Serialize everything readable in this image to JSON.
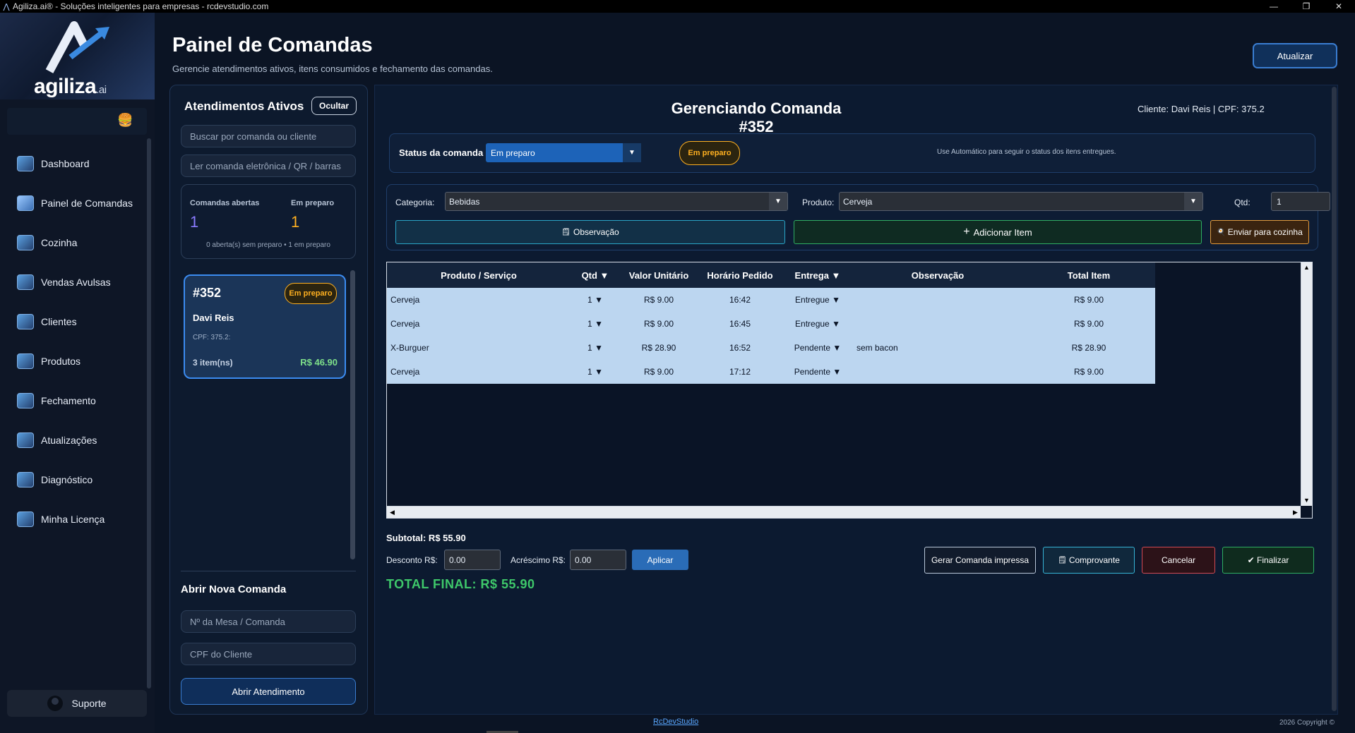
{
  "window": {
    "title": "Agiliza.ai® - Soluções inteligentes para empresas - rcdevstudio.com",
    "minimize": "—",
    "maximize": "❐",
    "close": "✕"
  },
  "sidebar": {
    "logo_main": "agiliza",
    "logo_suffix": ".ai",
    "items": [
      {
        "label": "Dashboard",
        "icon": "dashboard-icon"
      },
      {
        "label": "Painel de Comandas",
        "icon": "orders-panel-icon"
      },
      {
        "label": "Cozinha",
        "icon": "kitchen-icon"
      },
      {
        "label": "Vendas Avulsas",
        "icon": "sales-icon"
      },
      {
        "label": "Clientes",
        "icon": "clients-icon"
      },
      {
        "label": "Produtos",
        "icon": "products-icon"
      },
      {
        "label": "Fechamento",
        "icon": "closing-icon"
      },
      {
        "label": "Atualizações",
        "icon": "updates-icon"
      },
      {
        "label": "Diagnóstico",
        "icon": "diagnostics-icon"
      },
      {
        "label": "Minha Licença",
        "icon": "license-icon"
      }
    ],
    "support_label": "Suporte"
  },
  "header": {
    "title": "Painel de Comandas",
    "subtitle": "Gerencie atendimentos ativos, itens consumidos e fechamento das comandas.",
    "refresh_label": "Atualizar"
  },
  "active": {
    "title": "Atendimentos Ativos",
    "hide_label": "Ocultar",
    "search_placeholder": "Buscar por comanda ou cliente",
    "scan_placeholder": "Ler comanda eletrônica / QR / barras",
    "stats": {
      "open_label": "Comandas abertas",
      "open_value": "1",
      "prep_label": "Em preparo",
      "prep_value": "1",
      "note": "0 aberta(s) sem preparo • 1 em preparo"
    },
    "card": {
      "id": "#352",
      "status": "Em preparo",
      "name": "Davi Reis",
      "cpf": "CPF: 375.2:",
      "items": "3 item(ns)",
      "total": "R$ 46.90"
    },
    "new": {
      "title": "Abrir Nova Comanda",
      "table_placeholder": "Nº da Mesa / Comanda",
      "cpf_placeholder": "CPF do Cliente",
      "open_label": "Abrir Atendimento"
    }
  },
  "main": {
    "title": "Gerenciando Comanda #352",
    "client": "Cliente: Davi Reis  |  CPF: 375.2",
    "status": {
      "label": "Status da comanda",
      "value": "Em preparo",
      "badge": "Em preparo",
      "hint": "Use Automático para seguir o status dos itens entregues."
    },
    "add": {
      "category_label": "Categoria:",
      "category_value": "Bebidas",
      "product_label": "Produto:",
      "product_value": "Cerveja",
      "qty_label": "Qtd:",
      "qty_value": "1",
      "obs_label": "Observação",
      "add_label": "Adicionar Item",
      "kitchen_label": "Enviar para cozinha"
    },
    "table": {
      "headers": [
        "Produto / Serviço",
        "Qtd  ▼",
        "Valor Unitário",
        "Horário Pedido",
        "Entrega  ▼",
        "Observação",
        "Total Item"
      ],
      "rows": [
        {
          "produto": "Cerveja",
          "qtd": "1",
          "unit": "R$ 9.00",
          "hora": "16:42",
          "entrega": "Entregue",
          "obs": "",
          "total": "R$ 9.00"
        },
        {
          "produto": "Cerveja",
          "qtd": "1",
          "unit": "R$ 9.00",
          "hora": "16:45",
          "entrega": "Entregue",
          "obs": "",
          "total": "R$ 9.00"
        },
        {
          "produto": "X-Burguer",
          "qtd": "1",
          "unit": "R$ 28.90",
          "hora": "16:52",
          "entrega": "Pendente",
          "obs": "sem bacon",
          "total": "R$ 28.90"
        },
        {
          "produto": "Cerveja",
          "qtd": "1",
          "unit": "R$ 9.00",
          "hora": "17:12",
          "entrega": "Pendente",
          "obs": "",
          "total": "R$ 9.00"
        }
      ]
    },
    "subtotal": "Subtotal: R$ 55.90",
    "discount_label": "Desconto R$:",
    "discount_value": "0.00",
    "surcharge_label": "Acréscimo R$:",
    "surcharge_value": "0.00",
    "apply_label": "Aplicar",
    "total_final": "TOTAL FINAL: R$ 55.90",
    "buttons": {
      "print": "Gerar Comanda impressa",
      "receipt": "Comprovante",
      "cancel": "Cancelar",
      "finish": "✔ Finalizar"
    }
  },
  "footer": {
    "link": "RcDevStudio",
    "copyright": "2026 Copyright ©"
  }
}
